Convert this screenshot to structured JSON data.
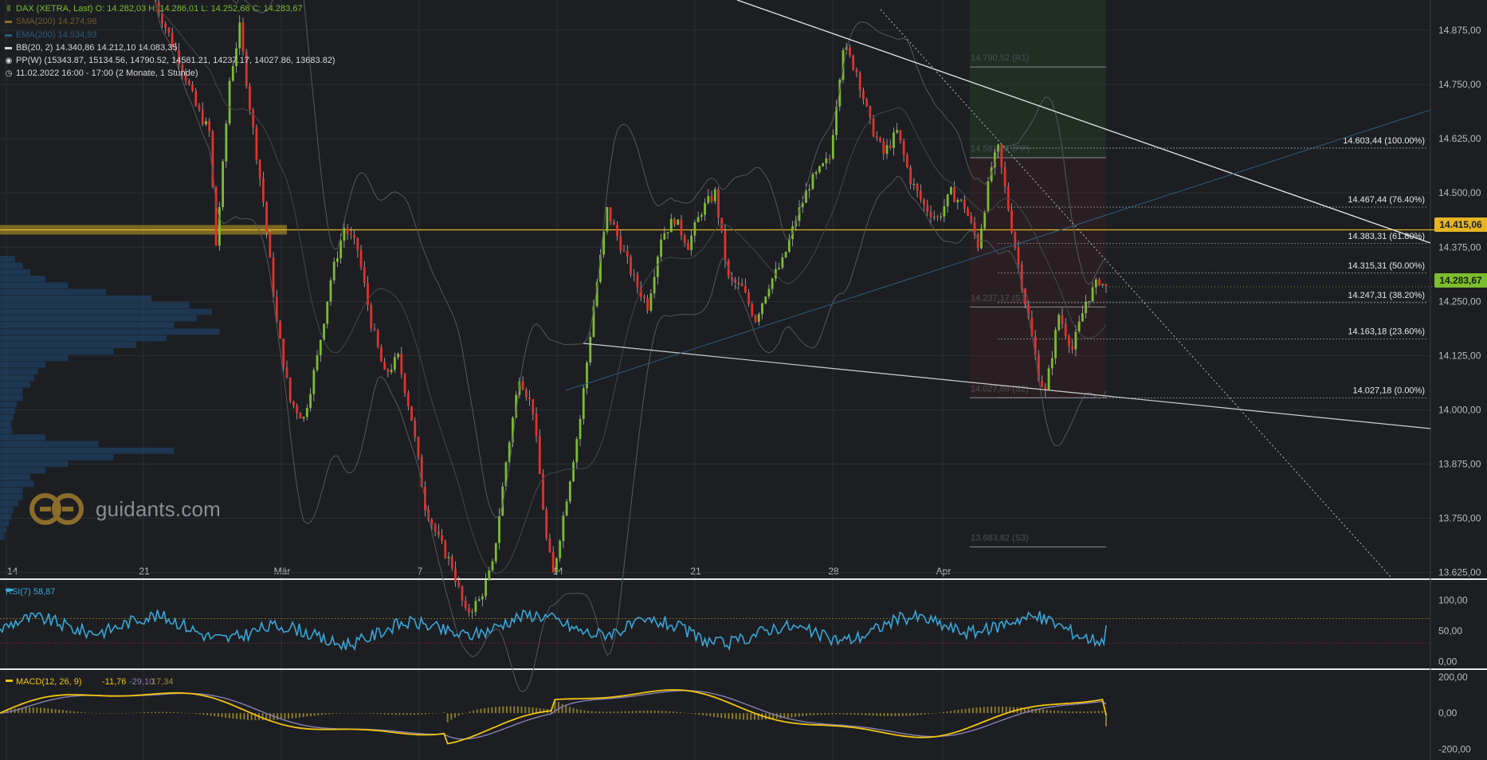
{
  "colors": {
    "bg": "#1c1e22",
    "grid": "#2b2e33",
    "up": "#7cbd2e",
    "down": "#e0322d",
    "rsi": "#3aa6d8",
    "macd": "#f1c40f",
    "signal": "#8a7fb0",
    "hline": "#e6b422",
    "last": "#7cbd2e",
    "bb": "#55585d"
  },
  "legend": {
    "dax": "DAX (XETRA, Last)  O: 14.282,03  H: 14.286,01  L: 14.252,68  C: 14.283,67",
    "sma": "SMA(200)  14.274,98",
    "ema": "EMA(200)  14.534,93",
    "bb": "BB(20, 2)  14.340,86  14.212,10  14.083,35",
    "pp": "PP(W)  (15343.87, 15134.56, 14790.52, 14581.21, 14237.17, 14027.86, 13683.82)",
    "time": "11.02.2022 16:00 - 17:00   (2 Monate, 1 Stunde)"
  },
  "logo_text": "guidants.com",
  "chart_data": {
    "type": "candlestick",
    "title": "DAX (XETRA, Last)",
    "x_ticks": [
      "14",
      "21",
      "Mär",
      "7",
      "14",
      "21",
      "28",
      "Apr"
    ],
    "y_ticks": [
      "14.875,00",
      "14.750,00",
      "14.625,00",
      "14.500,00",
      "14.375,00",
      "14.250,00",
      "14.125,00",
      "14.000,00",
      "13.875,00",
      "13.750,00",
      "13.625,00"
    ],
    "y_values": [
      14875,
      14750,
      14625,
      14500,
      14375,
      14250,
      14125,
      14000,
      13875,
      13750,
      13625
    ],
    "ylim": [
      13615,
      14945
    ],
    "last_price": "14.283,67",
    "last_value": 14283.67,
    "hline_label": "14.415,06",
    "hline_value": 14415.06,
    "fib_levels": [
      {
        "label": "14.603,44 (100.00%)",
        "value": 14603.44
      },
      {
        "label": "14.467,44 (76.40%)",
        "value": 14467.44
      },
      {
        "label": "14.383,31 (61.80%)",
        "value": 14383.31
      },
      {
        "label": "14.315,31 (50.00%)",
        "value": 14315.31
      },
      {
        "label": "14.247,31 (38.20%)",
        "value": 14247.31
      },
      {
        "label": "14.163,18 (23.60%)",
        "value": 14163.18
      },
      {
        "label": "14.027,18 (0.00%)",
        "value": 14027.18
      }
    ],
    "pivots": [
      {
        "label": "14.790,52 (R1)",
        "value": 14790.52
      },
      {
        "label": "14.581,21 (PP)",
        "value": 14581.21
      },
      {
        "label": "14.237,17 (S1)",
        "value": 14237.17
      },
      {
        "label": "14.027,86 (S2)",
        "value": 14027.86
      },
      {
        "label": "13.683,82 (S3)",
        "value": 13683.82
      }
    ],
    "anchors": [
      [
        0,
        14940
      ],
      [
        8,
        14790
      ],
      [
        12,
        14700
      ],
      [
        16,
        14640
      ],
      [
        18,
        14380
      ],
      [
        20,
        14560
      ],
      [
        22,
        14760
      ],
      [
        25,
        14880
      ],
      [
        28,
        14700
      ],
      [
        32,
        14480
      ],
      [
        36,
        14200
      ],
      [
        40,
        14020
      ],
      [
        44,
        13980
      ],
      [
        48,
        14120
      ],
      [
        52,
        14300
      ],
      [
        56,
        14420
      ],
      [
        60,
        14370
      ],
      [
        64,
        14200
      ],
      [
        68,
        14080
      ],
      [
        72,
        14120
      ],
      [
        76,
        13980
      ],
      [
        80,
        13780
      ],
      [
        84,
        13700
      ],
      [
        88,
        13640
      ],
      [
        92,
        13530
      ],
      [
        96,
        13560
      ],
      [
        100,
        13640
      ],
      [
        104,
        13880
      ],
      [
        108,
        14080
      ],
      [
        112,
        14000
      ],
      [
        116,
        13700
      ],
      [
        118,
        13620
      ],
      [
        122,
        13800
      ],
      [
        126,
        13980
      ],
      [
        130,
        14240
      ],
      [
        134,
        14460
      ],
      [
        138,
        14380
      ],
      [
        142,
        14300
      ],
      [
        146,
        14240
      ],
      [
        150,
        14400
      ],
      [
        154,
        14440
      ],
      [
        158,
        14380
      ],
      [
        162,
        14460
      ],
      [
        166,
        14500
      ],
      [
        170,
        14300
      ],
      [
        174,
        14280
      ],
      [
        178,
        14210
      ],
      [
        182,
        14290
      ],
      [
        186,
        14340
      ],
      [
        190,
        14440
      ],
      [
        194,
        14520
      ],
      [
        198,
        14560
      ],
      [
        200,
        14580
      ],
      [
        204,
        14840
      ],
      [
        208,
        14780
      ],
      [
        212,
        14660
      ],
      [
        216,
        14590
      ],
      [
        220,
        14640
      ],
      [
        224,
        14530
      ],
      [
        228,
        14470
      ],
      [
        232,
        14440
      ],
      [
        236,
        14500
      ],
      [
        240,
        14470
      ],
      [
        244,
        14380
      ],
      [
        248,
        14560
      ],
      [
        250,
        14600
      ],
      [
        254,
        14420
      ],
      [
        258,
        14250
      ],
      [
        262,
        14080
      ],
      [
        264,
        14040
      ],
      [
        268,
        14220
      ],
      [
        272,
        14140
      ],
      [
        276,
        14250
      ],
      [
        280,
        14300
      ],
      [
        282,
        14280
      ]
    ],
    "rsi": {
      "label": "RSI(7)  58,87",
      "value": 58.87,
      "ylim": [
        -10,
        120
      ],
      "ticks": [
        "100,00",
        "50,00",
        "0,00"
      ],
      "tick_values": [
        100,
        50,
        0
      ],
      "levels": [
        70,
        30
      ]
    },
    "macd": {
      "label": "MACD(12, 26, 9)",
      "value": "-11,76",
      "signal": "-29,10",
      "hist": "17,34",
      "ylim": [
        -260,
        230
      ],
      "ticks": [
        "200,00",
        "0,00",
        "-200,00"
      ],
      "tick_values": [
        200,
        0,
        -200
      ]
    }
  }
}
